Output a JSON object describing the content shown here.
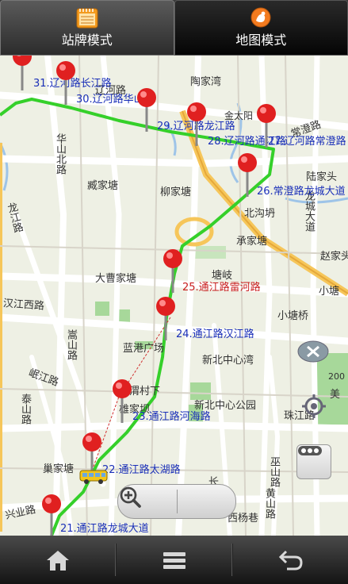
{
  "tabs": [
    {
      "label": "站牌模式",
      "icon": "notepad-icon"
    },
    {
      "label": "地图模式",
      "icon": "map-mode-icon"
    }
  ],
  "map": {
    "place_labels": [
      "陶家湾",
      "金太阳",
      "常澄路",
      "陆家头",
      "柳家塘",
      "臧家塘",
      "北沟坍",
      "龙城大道",
      "承家塘",
      "赵家头",
      "大曹家塘",
      "塘岐",
      "小塘",
      "小塘桥",
      "汉江西路",
      "嵩山路",
      "蓝港广场",
      "新北中心湾",
      "岷江路",
      "泰山路",
      "新北中心公园",
      "珠江路",
      "巢家塘",
      "长江路",
      "华山北路",
      "龙江路",
      "兴业路",
      "西杨巷",
      "巫山路",
      "黄山路",
      "雄家坝",
      "渭村下",
      "辽河路",
      "美",
      "200"
    ],
    "stops": [
      {
        "label": "21.通江路龙城大道"
      },
      {
        "label": "22.通江路太湖路"
      },
      {
        "label": "23.通江路河海路"
      },
      {
        "label": "24.通江路汉江路"
      },
      {
        "label": "25.通江路雷河路"
      },
      {
        "label": "26.常澄路龙城大道"
      },
      {
        "label": "27.辽河路常澄路"
      },
      {
        "label": "28.辽河路通江路"
      },
      {
        "label": "29.辽河路龙江路"
      },
      {
        "label": "30.辽河路华山路"
      },
      {
        "label": "31.辽河路长江路"
      }
    ]
  },
  "controls": {
    "zoom_out_icon": "zoom-out-icon",
    "zoom_in_icon": "zoom-in-icon",
    "close_icon": "close-icon",
    "locate_icon": "locate-icon",
    "more_icon": "more-icon"
  },
  "bottom_bar": [
    {
      "icon": "home-icon"
    },
    {
      "icon": "menu-icon"
    },
    {
      "icon": "back-icon"
    }
  ]
}
